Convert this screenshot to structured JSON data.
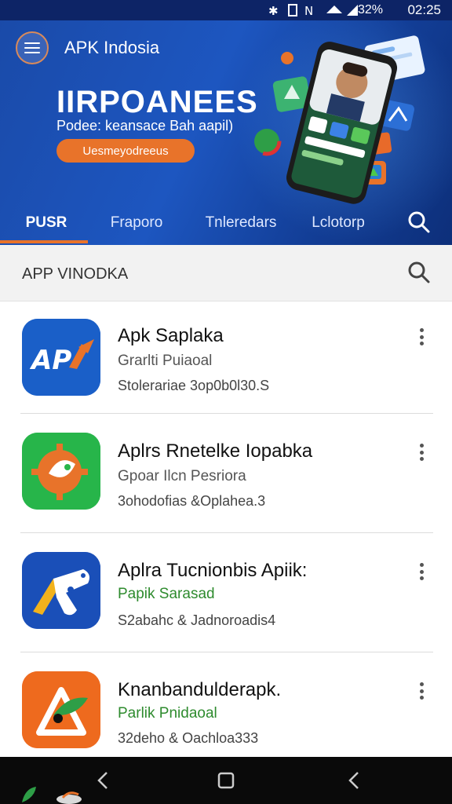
{
  "status_bar": {
    "battery": "32%",
    "time": "02:25"
  },
  "header": {
    "app_title": "APK Indosia",
    "headline": "IIRPOANEES",
    "subtitle": "Podee: keansace Bah aapil)",
    "cta_label": "Uesmeyodreeus"
  },
  "tabs": [
    {
      "label": "PUSR",
      "active": true
    },
    {
      "label": "Fraporo",
      "active": false
    },
    {
      "label": "Tnleredars",
      "active": false
    },
    {
      "label": "Lclotorp",
      "active": false
    }
  ],
  "section": {
    "title": "APP VINODKA"
  },
  "apps": [
    {
      "name": "Apk Saplaka",
      "developer": "Grarlti Puiaoal",
      "meta": "Stolerariae 3op0b0l30.S",
      "developer_color": "gray",
      "icon": "apk-logo-icon"
    },
    {
      "name": "Aplrs Rnetelke Iopabka",
      "developer": "Gpoar Ilcn Pesriora",
      "meta": "3ohodofias &Oplahea.3",
      "developer_color": "gray",
      "icon": "gear-leaf-icon"
    },
    {
      "name": "Aplra Tucnionbis Apiik:",
      "developer": "Papik Sarasad",
      "meta": "S2abahc & Jadnoroadis4",
      "developer_color": "green",
      "icon": "wrench-arm-icon"
    },
    {
      "name": "Knanbandulderapk.",
      "developer": "Parlik Pnidaoal",
      "meta": "32deho & Oachloa333",
      "developer_color": "green",
      "icon": "star-leaf-icon"
    }
  ],
  "colors": {
    "header_blue": "#1d56c0",
    "accent_orange": "#e8732a",
    "green_text": "#2e8b2e"
  }
}
